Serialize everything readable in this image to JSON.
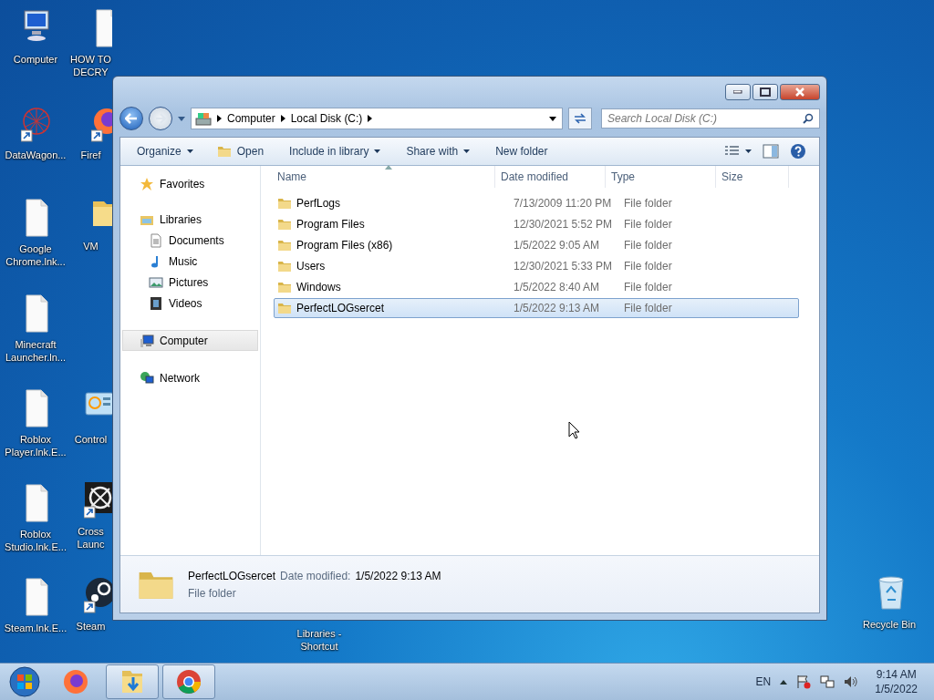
{
  "desktop_icons": [
    {
      "label": "Computer",
      "kind": "computer",
      "shortcut": false
    },
    {
      "label": "DataWagon...",
      "kind": "network-graph",
      "shortcut": true
    },
    {
      "label": "Google Chrome.lnk...",
      "kind": "document",
      "shortcut": false
    },
    {
      "label": "Minecraft Launcher.ln...",
      "kind": "document",
      "shortcut": false
    },
    {
      "label": "Roblox Player.lnk.E...",
      "kind": "document",
      "shortcut": false
    },
    {
      "label": "Roblox Studio.lnk.E...",
      "kind": "document",
      "shortcut": false
    },
    {
      "label": "Steam.lnk.E...",
      "kind": "document",
      "shortcut": false
    },
    {
      "label": "HOW TO DECRY",
      "kind": "document",
      "shortcut": false
    },
    {
      "label": "Firef",
      "kind": "firefox",
      "shortcut": true
    },
    {
      "label": "VM",
      "kind": "folder",
      "shortcut": false
    },
    {
      "label": "Control",
      "kind": "control-panel",
      "shortcut": false
    },
    {
      "label": "Cross Launc",
      "kind": "crosshair",
      "shortcut": true
    },
    {
      "label": "Steam",
      "kind": "steam",
      "shortcut": true
    },
    {
      "label": "Libraries - Shortcut",
      "kind": "none"
    },
    {
      "label": "Recycle Bin",
      "kind": "recycle-bin",
      "shortcut": false
    }
  ],
  "window": {
    "breadcrumb": [
      "Computer",
      "Local Disk (C:)"
    ],
    "search": {
      "placeholder": "Search Local Disk (C:)"
    },
    "toolbar": [
      {
        "label": "Organize",
        "kind": "menu"
      },
      {
        "label": "Open",
        "kind": "open"
      },
      {
        "label": "Include in library",
        "kind": "menu"
      },
      {
        "label": "Share with",
        "kind": "menu"
      },
      {
        "label": "New folder",
        "kind": "plain"
      }
    ],
    "nav": [
      {
        "label": "Favorites",
        "kind": "star",
        "selected": false
      },
      {
        "label": "Libraries",
        "kind": "libraries",
        "selected": false,
        "children": [
          {
            "label": "Documents",
            "kind": "documents",
            "selected": false
          },
          {
            "label": "Music",
            "kind": "music",
            "selected": false
          },
          {
            "label": "Pictures",
            "kind": "pictures",
            "selected": false
          },
          {
            "label": "Videos",
            "kind": "videos",
            "selected": false
          }
        ]
      },
      {
        "label": "Computer",
        "kind": "computer",
        "selected": true
      },
      {
        "label": "Network",
        "kind": "network",
        "selected": false
      }
    ],
    "columns": [
      {
        "label": "Name",
        "sorted": true
      },
      {
        "label": "Date modified",
        "sorted": false
      },
      {
        "label": "Type",
        "sorted": false
      },
      {
        "label": "Size",
        "sorted": false
      }
    ],
    "rows": [
      {
        "name": "PerfLogs",
        "date": "7/13/2009 11:20 PM",
        "type": "File folder",
        "selected": false
      },
      {
        "name": "Program Files",
        "date": "12/30/2021 5:52 PM",
        "type": "File folder",
        "selected": false
      },
      {
        "name": "Program Files (x86)",
        "date": "1/5/2022 9:05 AM",
        "type": "File folder",
        "selected": false
      },
      {
        "name": "Users",
        "date": "12/30/2021 5:33 PM",
        "type": "File folder",
        "selected": false
      },
      {
        "name": "Windows",
        "date": "1/5/2022 8:40 AM",
        "type": "File folder",
        "selected": false
      },
      {
        "name": "PerfectLOGsercet",
        "date": "1/5/2022 9:13 AM",
        "type": "File folder",
        "selected": true
      }
    ],
    "details": {
      "name": "PerfectLOGsercet",
      "date_label": "Date modified:",
      "date": "1/5/2022 9:13 AM",
      "type": "File folder"
    }
  },
  "taskbar": {
    "apps": [
      {
        "kind": "firefox",
        "running": false
      },
      {
        "kind": "explorer",
        "running": true
      },
      {
        "kind": "chrome",
        "running": true
      }
    ],
    "language": "EN",
    "time": "9:14 AM",
    "date": "1/5/2022"
  }
}
